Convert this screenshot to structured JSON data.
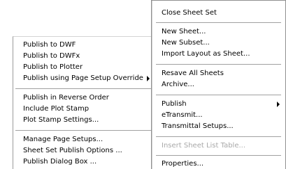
{
  "publish_submenu": {
    "items": [
      "Publish to DWF",
      "Publish to DWFx",
      "Publish to Plotter",
      "Publish using Page Setup Override",
      "Publish in Reverse Order",
      "Include Plot Stamp",
      "Plot Stamp Settings...",
      "Manage Page Setups...",
      "Sheet Set Publish Options ...",
      "Publish Dialog Box ..."
    ]
  },
  "context_menu": {
    "items": [
      "Close Sheet Set",
      "New Sheet...",
      "New Subset...",
      "Import Layout as Sheet...",
      "Resave All Sheets",
      "Archive...",
      "Publish",
      "eTransmit...",
      "Transmittal Setups...",
      "Insert Sheet List Table...",
      "Properties..."
    ]
  }
}
